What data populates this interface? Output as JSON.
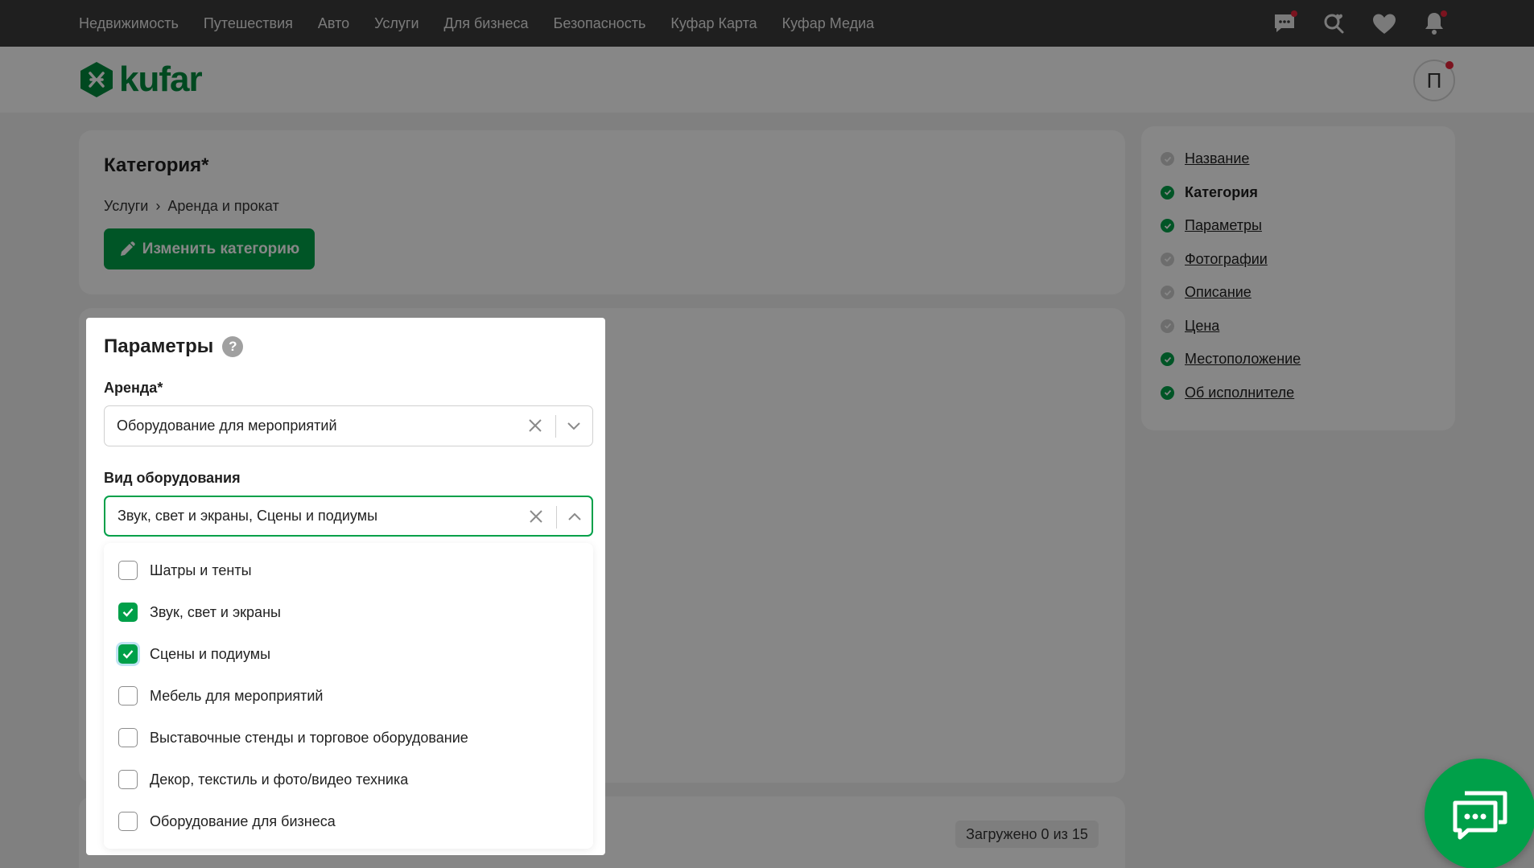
{
  "topnav": {
    "links": [
      "Недвижимость",
      "Путешествия",
      "Авто",
      "Услуги",
      "Для бизнеса",
      "Безопасность",
      "Куфар Карта",
      "Куфар Медиа"
    ]
  },
  "header": {
    "logo_text": "kufar",
    "avatar_initial": "П"
  },
  "category": {
    "title": "Категория*",
    "crumb1": "Услуги",
    "separator": "›",
    "crumb2": "Аренда и прокат",
    "change_button": "Изменить категорию"
  },
  "sidebar": {
    "items": [
      {
        "label": "Название",
        "done": false
      },
      {
        "label": "Категория",
        "done": true,
        "current": true
      },
      {
        "label": "Параметры",
        "done": true
      },
      {
        "label": "Фотографии",
        "done": false
      },
      {
        "label": "Описание",
        "done": false
      },
      {
        "label": "Цена",
        "done": false
      },
      {
        "label": "Местоположение",
        "done": true
      },
      {
        "label": "Об исполнителе",
        "done": true
      }
    ]
  },
  "params": {
    "title": "Параметры",
    "help": "?",
    "rent_label": "Аренда*",
    "rent_value": "Оборудование для мероприятий",
    "equip_label": "Вид оборудования",
    "equip_value": "Звук, свет и экраны, Сцены и подиумы",
    "options": [
      {
        "label": "Шатры и тенты",
        "checked": false
      },
      {
        "label": "Звук, свет и экраны",
        "checked": true
      },
      {
        "label": "Сцены и подиумы",
        "checked": true,
        "focused": true
      },
      {
        "label": "Мебель для мероприятий",
        "checked": false
      },
      {
        "label": "Выставочные стенды и торговое оборудование",
        "checked": false
      },
      {
        "label": "Декор, текстиль и фото/видео техника",
        "checked": false
      },
      {
        "label": "Оборудование для бизнеса",
        "checked": false
      }
    ]
  },
  "photos": {
    "uploaded": "Загружено 0 из 15"
  },
  "colors": {
    "brand": "#00a049",
    "notification": "#e8253b"
  }
}
